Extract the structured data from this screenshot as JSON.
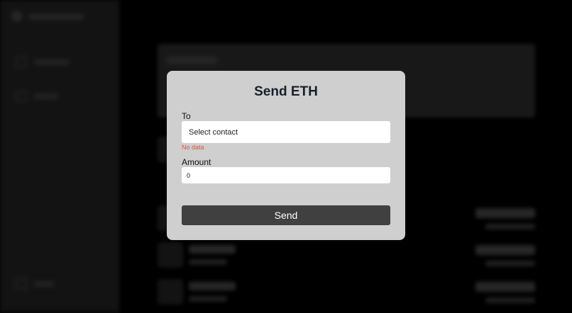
{
  "modal": {
    "title": "Send ETH",
    "to_label": "To",
    "to_select_value": "Select contact",
    "to_error": "No data",
    "amount_label": "Amount",
    "amount_value": "0",
    "send_label": "Send"
  },
  "colors": {
    "modal_bg": "#cfcfcf",
    "title": "#17212b",
    "error": "#e0533d",
    "button": "#404040",
    "backdrop": "#000000"
  },
  "icons": [
    "app-logo-icon",
    "nav-dashboard-icon",
    "nav-contacts-icon",
    "logout-icon"
  ]
}
